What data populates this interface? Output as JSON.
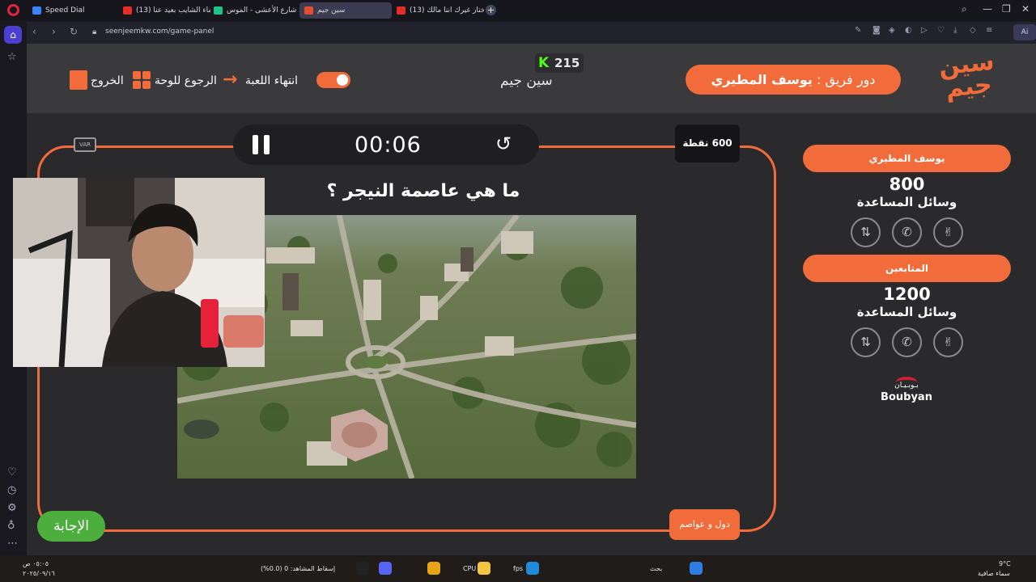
{
  "browser": {
    "tabs": [
      {
        "label": "Speed Dial",
        "color": "#3b82f6"
      },
      {
        "label": "(13) شيماء الشايب بعيد عنا...",
        "color": "#e52d27"
      },
      {
        "label": "شاهد شارع الأعشى - الموس...",
        "color": "#1ec28b"
      },
      {
        "label": "سين جيم",
        "color": "#e44c2e"
      },
      {
        "label": "(13) راح اختار غيرك اننا مالك...",
        "color": "#e52d27"
      }
    ],
    "new_tab": "+",
    "url": "seenjeemkw.com/game-panel",
    "aria": "Ai",
    "window_controls": [
      "—",
      "❐",
      "✕"
    ]
  },
  "header": {
    "exit": "الخروج",
    "back_to_board": "الرجوع للوحة",
    "end_game": "انتهاء اللعبة",
    "game_name": "سين جيم",
    "kick_icon": "K",
    "kick_count": "215",
    "turn_label": "دور فريق :",
    "turn_team": "يوسف المطيري",
    "logo_line1": "سين",
    "logo_line2": "جيم"
  },
  "board": {
    "timer": "00:06",
    "var_label": "VAR",
    "points": "600 نقطة",
    "question": "ما هي عاصمة النيجر ؟",
    "category": "دول و عواصم",
    "answer_button": "الإجابة"
  },
  "teams": [
    {
      "name": "يوسف المطيري",
      "score": "800",
      "aids_label": "وسائل المساعدة"
    },
    {
      "name": "المتابعين",
      "score": "1200",
      "aids_label": "وسائل المساعدة"
    }
  ],
  "aid_icons": [
    "two-hands-icon",
    "phone-icon",
    "victory-hand-icon"
  ],
  "sponsor": {
    "arabic": "بـوبـيـان",
    "english": "Boubyan"
  },
  "taskbar": {
    "time": "٠٥:٠٥ ص",
    "date": "٢٠٢٥/٠٩/١٦",
    "stream_status": "إسقاط المشاهد: 0 (0.0%)",
    "search": "بحث",
    "weather_temp": "9°C",
    "weather_desc": "سماء صافية",
    "cpu": "CPU",
    "fps": "fps"
  },
  "colors": {
    "accent": "#f26b3a",
    "answer_green": "#4caf3d",
    "kick_green": "#53fc18"
  }
}
